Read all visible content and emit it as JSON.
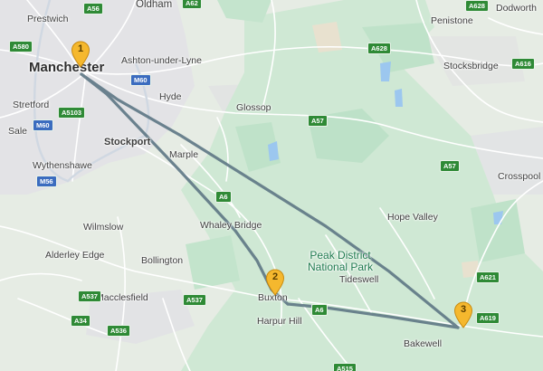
{
  "colors": {
    "background": "#e6ece4",
    "urban": "#e4e4e6",
    "park": "#c7e6d0",
    "forest": "#b9e0c4",
    "water": "#9cc7ef",
    "road": "#ffffff",
    "major_road": "#d6dde4",
    "route": "#5e7785",
    "marker": "#f5b82e",
    "shield": "#2f8a36"
  },
  "places": {
    "prestwich": "Prestwich",
    "oldham": "Oldham",
    "penistone": "Penistone",
    "manchester": "Manchester",
    "ashton": "Ashton-under-Lyne",
    "stocksbridge": "Stocksbridge",
    "hyde": "Hyde",
    "stretford": "Stretford",
    "glossop": "Glossop",
    "sale": "Sale",
    "stockport": "Stockport",
    "dodworth": "Dodworth",
    "marple": "Marple",
    "wythenshawe": "Wythenshawe",
    "crosspool": "Crosspool",
    "hope_valley": "Hope Valley",
    "whaley_bridge": "Whaley Bridge",
    "wilmslow": "Wilmslow",
    "peak_district": "Peak District\nNational Park",
    "alderley_edge": "Alderley Edge",
    "bollington": "Bollington",
    "tideswell": "Tideswell",
    "macclesfield": "Macclesfield",
    "buxton": "Buxton",
    "harpur_hill": "Harpur Hill",
    "bakewell": "Bakewell"
  },
  "road_shields": {
    "a56_top": "A56",
    "a62": "A62",
    "a628_top": "A628",
    "a580": "A580",
    "a628": "A628",
    "a616": "A616",
    "m60_east": "M60",
    "a57_mid": "A57",
    "a5103": "A5103",
    "m60_west": "M60",
    "a57_east": "A57",
    "m56": "M56",
    "a6_mid": "A6",
    "a537_west": "A537",
    "a537": "A537",
    "a621": "A621",
    "a34": "A34",
    "a536": "A536",
    "a619": "A619",
    "a6_south": "A6",
    "a515": "A515"
  },
  "markers": [
    {
      "label": "1",
      "icon": "map-pin-icon"
    },
    {
      "label": "2",
      "icon": "map-pin-icon"
    },
    {
      "label": "3",
      "icon": "map-pin-icon"
    }
  ]
}
